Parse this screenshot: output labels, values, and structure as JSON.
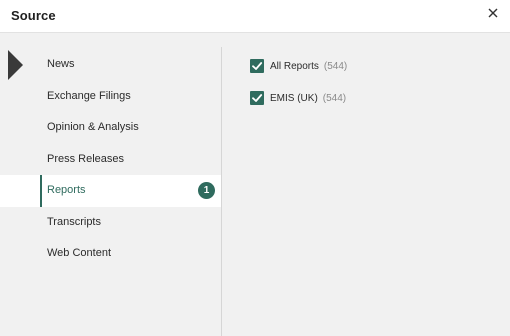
{
  "dialog": {
    "title": "Source",
    "close_icon": "close-icon"
  },
  "sources": [
    {
      "label": "News"
    },
    {
      "label": "Exchange Filings"
    },
    {
      "label": "Opinion & Analysis"
    },
    {
      "label": "Press Releases"
    },
    {
      "label": "Reports",
      "selected": true,
      "badge": "1"
    },
    {
      "label": "Transcripts"
    },
    {
      "label": "Web Content"
    }
  ],
  "filters": [
    {
      "label": "All Reports",
      "count": "(544)",
      "checked": true
    },
    {
      "label": "EMIS (UK)",
      "count": "(544)",
      "checked": true
    }
  ],
  "colors": {
    "accent": "#2f6b5e",
    "panel_bg": "#f1f1f1",
    "selected_bg": "#ffffff"
  }
}
